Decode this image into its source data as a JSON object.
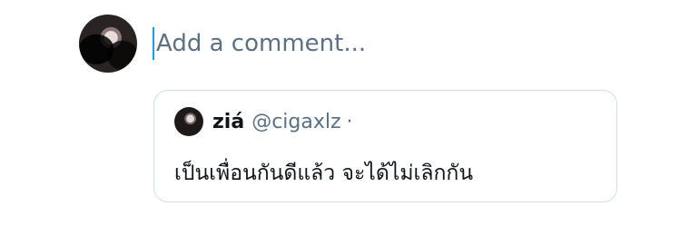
{
  "composer": {
    "placeholder": "Add a comment..."
  },
  "quoted_tweet": {
    "display_name": "ziá",
    "handle": "@cigaxlz",
    "separator": "·",
    "text": "เป็นเพื่อนกันดีแล้ว จะได้ไม่เลิกกัน"
  },
  "colors": {
    "accent": "#1d9bf0",
    "secondary_text": "#5b7083",
    "primary_text": "#0f1419",
    "card_border": "#d5dde3"
  },
  "icons": {
    "user_avatar": "avatar",
    "quoted_avatar": "avatar"
  }
}
